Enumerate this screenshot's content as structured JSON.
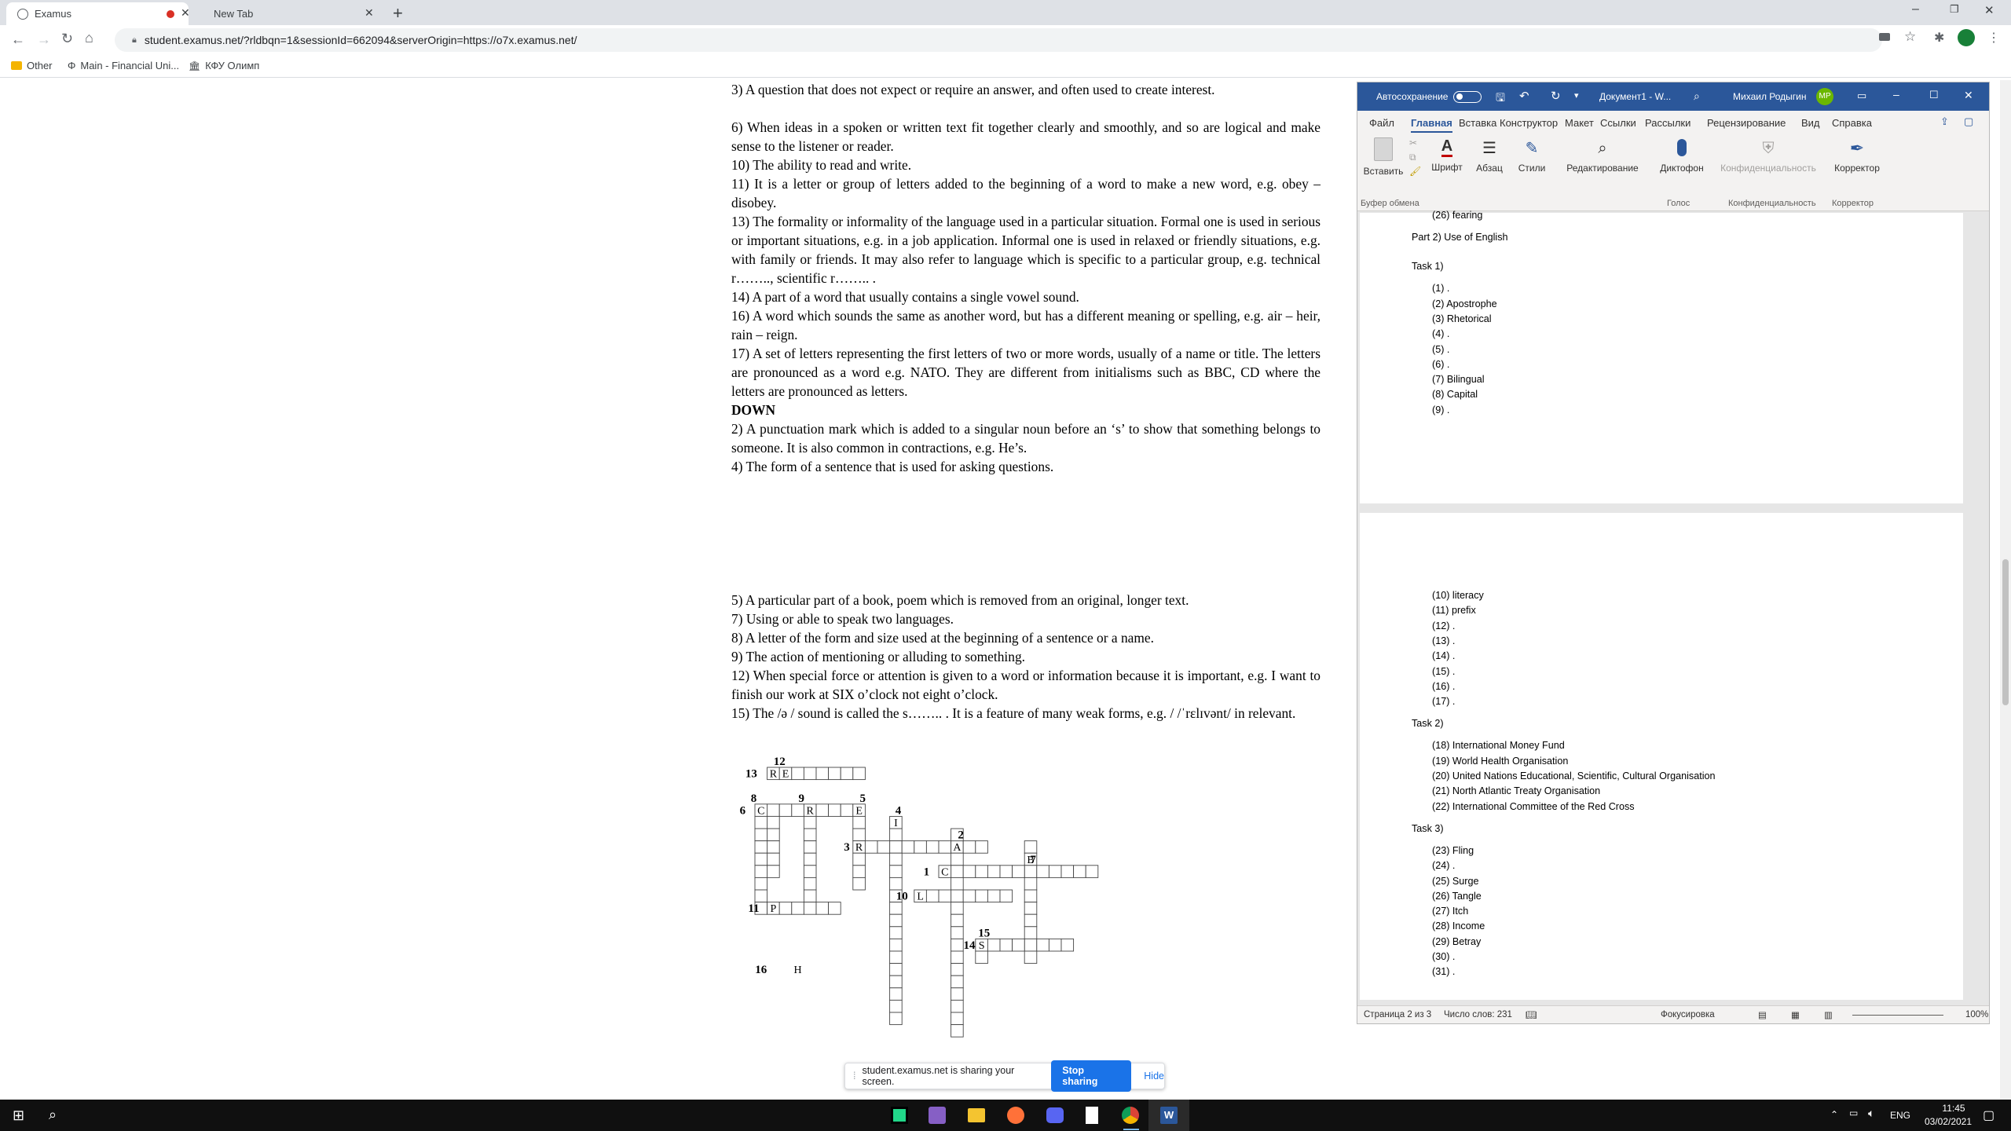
{
  "browser": {
    "tabs": [
      {
        "label": "Examus"
      },
      {
        "label": "New Tab"
      }
    ],
    "url": "student.examus.net/?rldbqn=1&sessionId=662094&serverOrigin=https://o7x.examus.net/",
    "bookmarks": [
      "Other",
      "Main - Financial Uni...",
      "КФУ Олимп"
    ]
  },
  "exam": {
    "clues_top": [
      "3) A question that does not expect or require an answer, and often used to create interest.",
      "6) When ideas in a spoken or written text fit together clearly and smoothly, and so are logical and make sense to the listener or reader.",
      "10) The ability to read and write.",
      "11) It is a letter or group of letters added to the beginning of a word to make a new word, e.g. obey – disobey.",
      "13) The formality or informality of the language used in a particular situation. Formal one is used in serious or important situations, e.g. in a job application. Informal one is used in relaxed or friendly situations, e.g. with family or friends. It may also refer to language which is specific to a particular group, e.g. technical r…….., scientific r…….. .",
      "14) A part of a word that usually contains a single vowel sound.",
      "16) A word which sounds the same as another word, but has a different meaning or spelling, e.g. air – heir, rain – reign.",
      "17) A set of letters representing the first letters of two or more words, usually of a name or title. The letters are pronounced as a word e.g. NATO. They are different from initialisms such as BBC, CD where the letters are pronounced as letters."
    ],
    "down_heading": "DOWN",
    "clues_down_a": [
      "2) A punctuation mark which is added to a singular noun before an ‘s’ to show that something belongs to someone. It is also common in contractions, e.g. He’s.",
      "4) The form of a sentence that is used for asking questions."
    ],
    "clues_down_b": [
      "5) A particular part of a book, poem which is removed from an original, longer text.",
      "7) Using or able to speak two languages.",
      "8) A letter of the form and size used at the beginning of a sentence or a name.",
      "9) The action of mentioning or alluding to something.",
      "12) When special force or attention is given to a word or information because it is important, e.g. I want to finish our work at SIX o’clock not eight  o’clock.",
      "15) The /ə / sound is called the s…….. . It is a feature of many weak forms, e.g. / /ˈrɛlɪvənt/ in relevant."
    ],
    "grid_numbers": [
      "12",
      "13",
      "8",
      "9",
      "5",
      "6",
      "4",
      "2",
      "3",
      "7",
      "1",
      "10",
      "11",
      "15",
      "14",
      "16"
    ],
    "grid_letters": [
      "R",
      "E",
      "C",
      "R",
      "E",
      "I",
      "R",
      "A",
      "B",
      "C",
      "L",
      "P",
      "S",
      "H"
    ]
  },
  "word": {
    "autosave_label": "Автосохранение",
    "doc_title": "Документ1 - W...",
    "user_name": "Михаил Родыгин",
    "user_initials": "МР",
    "tabs": [
      "Файл",
      "Главная",
      "Вставка",
      "Конструктор",
      "Макет",
      "Ссылки",
      "Рассылки",
      "Рецензирование",
      "Вид",
      "Справка"
    ],
    "ribbon": {
      "paste": "Вставить",
      "font": "Шрифт",
      "paragraph": "Абзац",
      "styles": "Стили",
      "editing": "Редактирование",
      "dictate": "Диктофон",
      "privacy": "Конфиденциальность",
      "corrector": "Корректор",
      "group_clipboard": "Буфер обмена",
      "group_voice": "Голос",
      "group_privacy": "Конфиденциальность",
      "group_corrector": "Корректор"
    },
    "page1_lines": [
      {
        "text": "(26) fearing",
        "indent": 1
      },
      {
        "text": "Part 2) Use of English",
        "indent": 0
      },
      {
        "text": "Task 1)",
        "indent": 0
      },
      {
        "text": "(1)  .",
        "indent": 1
      },
      {
        "text": "(2)  Apostrophe",
        "indent": 1
      },
      {
        "text": "(3)  Rhetorical",
        "indent": 1
      },
      {
        "text": "(4)  .",
        "indent": 1
      },
      {
        "text": "(5)  .",
        "indent": 1
      },
      {
        "text": "(6)  .",
        "indent": 1
      },
      {
        "text": "(7)  Bilingual",
        "indent": 1
      },
      {
        "text": "(8)  Capital",
        "indent": 1
      },
      {
        "text": "(9)  .",
        "indent": 1
      }
    ],
    "page2_lines": [
      {
        "text": "(10) literacy",
        "indent": 1
      },
      {
        "text": "(11) prefix",
        "indent": 1
      },
      {
        "text": "(12) .",
        "indent": 1
      },
      {
        "text": "(13) .",
        "indent": 1
      },
      {
        "text": "(14) .",
        "indent": 1
      },
      {
        "text": "(15) .",
        "indent": 1
      },
      {
        "text": "(16) .",
        "indent": 1
      },
      {
        "text": "(17) .",
        "indent": 1
      },
      {
        "text": "Task 2)",
        "indent": 0
      },
      {
        "text": "(18) International Money Fund",
        "indent": 1
      },
      {
        "text": "(19) World Health Organisation",
        "indent": 1
      },
      {
        "text": "(20) United Nations Educational, Scientific, Cultural Organisation",
        "indent": 1
      },
      {
        "text": "(21) North Atlantic Treaty Organisation",
        "indent": 1
      },
      {
        "text": "(22) International Committee of the Red Cross",
        "indent": 1
      },
      {
        "text": "Task 3)",
        "indent": 0
      },
      {
        "text": "(23) Fling",
        "indent": 1
      },
      {
        "text": "(24) .",
        "indent": 1
      },
      {
        "text": "(25) Surge",
        "indent": 1
      },
      {
        "text": "(26) Tangle",
        "indent": 1
      },
      {
        "text": "(27) Itch",
        "indent": 1
      },
      {
        "text": "(28) Income",
        "indent": 1
      },
      {
        "text": "(29) Betray",
        "indent": 1
      },
      {
        "text": "(30) .",
        "indent": 1
      },
      {
        "text": "(31) .",
        "indent": 1
      }
    ],
    "status": {
      "page": "Страница 2 из 3",
      "words": "Число слов: 231",
      "focus": "Фокусировка",
      "zoom": "100%"
    }
  },
  "share_bar": {
    "text": "student.examus.net is sharing your screen.",
    "stop": "Stop sharing",
    "hide": "Hide"
  },
  "taskbar": {
    "lang": "ENG",
    "time": "11:45",
    "date": "03/02/2021"
  },
  "colors": {
    "word_blue": "#2b579a",
    "chrome_tabstrip": "#dee1e6",
    "share_blue": "#1a73e8"
  }
}
